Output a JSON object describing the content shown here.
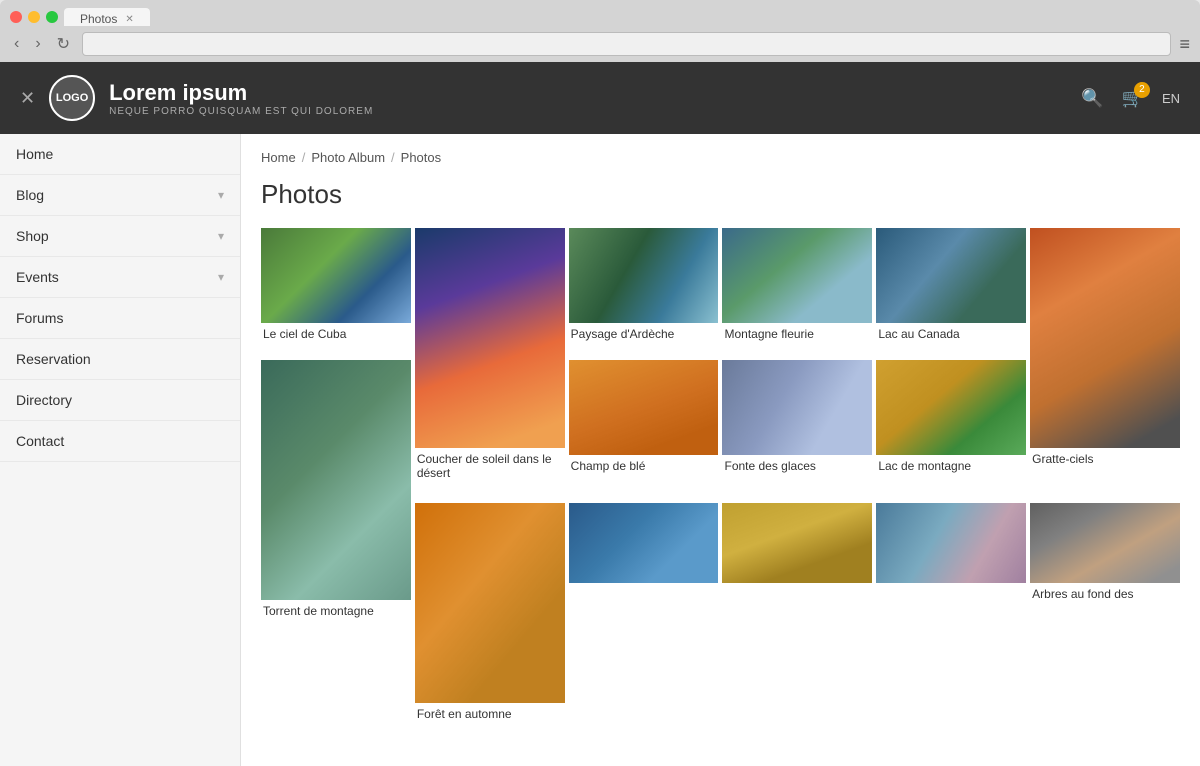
{
  "browser": {
    "tab_title": "Photos",
    "address": "",
    "menu_icon": "≡"
  },
  "header": {
    "logo_text": "LOGO",
    "brand_title": "Lorem ipsum",
    "brand_subtitle": "NEQUE PORRO QUISQUAM EST QUI DOLOREM",
    "cart_badge": "2",
    "lang": "EN"
  },
  "sidebar": {
    "items": [
      {
        "label": "Home",
        "has_chevron": false
      },
      {
        "label": "Blog",
        "has_chevron": true
      },
      {
        "label": "Shop",
        "has_chevron": true
      },
      {
        "label": "Events",
        "has_chevron": true
      },
      {
        "label": "Forums",
        "has_chevron": false
      },
      {
        "label": "Reservation",
        "has_chevron": false
      },
      {
        "label": "Directory",
        "has_chevron": false
      },
      {
        "label": "Contact",
        "has_chevron": false
      }
    ]
  },
  "breadcrumb": {
    "items": [
      "Home",
      "Photo Album",
      "Photos"
    ]
  },
  "main": {
    "page_title": "Photos",
    "photos": [
      {
        "id": 1,
        "caption": "Le ciel de Cuba",
        "color_class": "col1"
      },
      {
        "id": 2,
        "caption": "Coucher de soleil dans le désert",
        "color_class": "col2",
        "tall": true
      },
      {
        "id": 3,
        "caption": "Paysage d'Ardèche",
        "color_class": "col3"
      },
      {
        "id": 4,
        "caption": "Montagne fleurie",
        "color_class": "col4"
      },
      {
        "id": 5,
        "caption": "Lac au Canada",
        "color_class": "col5"
      },
      {
        "id": 6,
        "caption": "Gratte-ciels",
        "color_class": "col6",
        "tall": true
      },
      {
        "id": 7,
        "caption": "Torrent de montagne",
        "color_class": "col7",
        "tall": true
      },
      {
        "id": 8,
        "caption": "Champ de blé",
        "color_class": "col8"
      },
      {
        "id": 9,
        "caption": "Fonte des glaces",
        "color_class": "col9"
      },
      {
        "id": 10,
        "caption": "Lac de montagne",
        "color_class": "col10"
      },
      {
        "id": 11,
        "caption": "Forêt en automne",
        "color_class": "col11",
        "tall": true
      },
      {
        "id": 12,
        "caption": "Arbres au fond des",
        "color_class": "col12"
      }
    ]
  }
}
